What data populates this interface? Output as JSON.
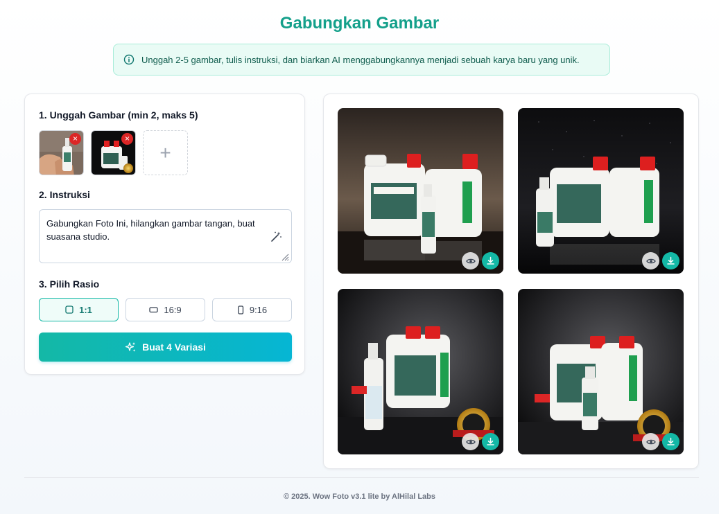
{
  "page": {
    "title": "Gabungkan Gambar"
  },
  "info": {
    "text": "Unggah 2-5 gambar, tulis instruksi, dan biarkan AI menggabungkannya menjadi sebuah karya baru yang unik."
  },
  "left_panel": {
    "upload_heading": "1. Unggah Gambar (min 2, maks 5)",
    "uploaded_count": 2,
    "add_symbol": "+",
    "delete_symbol": "×",
    "instruction_heading": "2. Instruksi",
    "instruction_value": "Gabungkan Foto Ini, hilangkan gambar tangan, buat suasana studio.",
    "ratio_heading": "3. Pilih Rasio",
    "ratios": [
      {
        "label": "1:1",
        "active": true
      },
      {
        "label": "16:9",
        "active": false
      },
      {
        "label": "9:16",
        "active": false
      }
    ],
    "generate_label": "Buat 4 Variasi"
  },
  "results": {
    "count": 4
  },
  "footer": {
    "text": "© 2025. Wow Foto v3.1 lite by AlHilal Labs"
  },
  "colors": {
    "accent": "#14a08b",
    "button_start": "#14b8a6",
    "button_end": "#06b6d4",
    "delete": "#dc2626"
  },
  "icons": [
    "info-icon",
    "close-icon",
    "plus-icon",
    "magic-wand-icon",
    "square-icon",
    "landscape-icon",
    "portrait-icon",
    "sparkles-icon",
    "eye-icon",
    "download-icon"
  ]
}
